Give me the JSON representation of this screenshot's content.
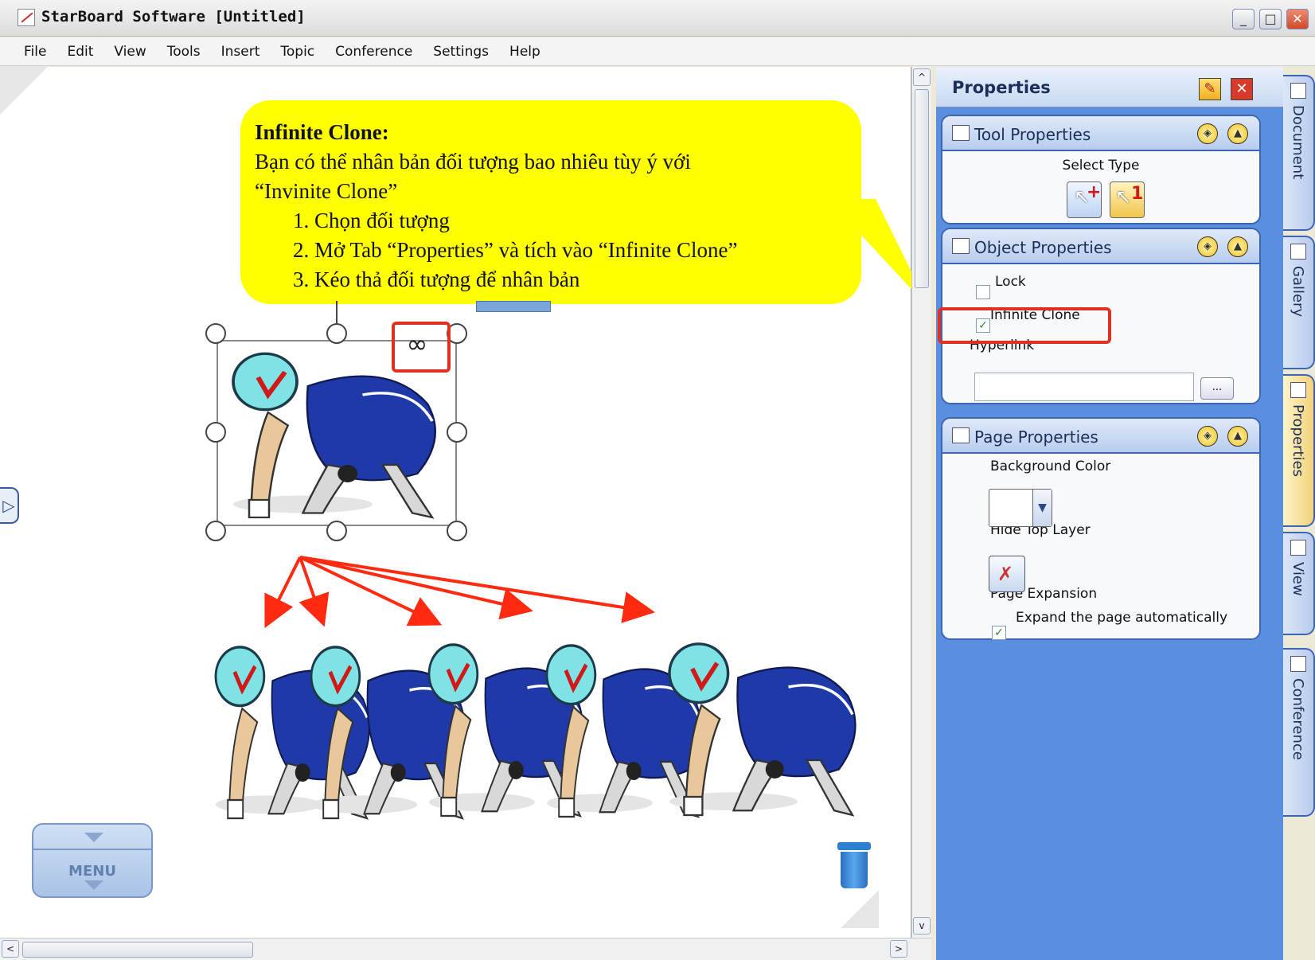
{
  "window": {
    "title": "StarBoard Software [Untitled]"
  },
  "menu": [
    "File",
    "Edit",
    "View",
    "Tools",
    "Insert",
    "Topic",
    "Conference",
    "Settings",
    "Help"
  ],
  "callout": {
    "heading": "Infinite Clone:",
    "line1": "Bạn có thể nhân bản đối tượng bao nhiêu tùy ý với",
    "line2": "“Invinite Clone”",
    "steps": [
      "1.  Chọn đối tượng",
      "2.  Mở Tab “Properties” và tích vào “Infinite Clone”",
      "3.  Kéo thả đối tượng để nhân bản"
    ]
  },
  "canvas": {
    "infinite_symbol": "∞",
    "menu_button_label": "MENU",
    "scroll_up": "^",
    "scroll_down": "v",
    "scroll_left": "<",
    "scroll_right": ">",
    "left_tab_arrow": "▷"
  },
  "panel": {
    "title": "Properties",
    "tool_properties": {
      "title": "Tool Properties",
      "select_type_label": "Select Type",
      "button_plus": "+",
      "button_one": "1"
    },
    "object_properties": {
      "title": "Object Properties",
      "lock_label": "Lock",
      "lock_checked": false,
      "infinite_clone_label": "Infinite Clone",
      "infinite_clone_checked": true,
      "hyperlink_label": "Hyperlink",
      "hyperlink_value": "",
      "browse_button": "..."
    },
    "page_properties": {
      "title": "Page Properties",
      "background_color_label": "Background Color",
      "background_color": "#ffffff",
      "hide_top_layer_label": "Hide Top Layer",
      "page_expansion_label": "Page Expansion",
      "expand_label": "Expand the page automatically",
      "expand_checked": true
    }
  },
  "side_tabs": [
    "Document",
    "Gallery",
    "Properties",
    "View",
    "Conference"
  ],
  "colors": {
    "callout": "#ffff00",
    "panel_bg": "#5a8fe0",
    "highlight_red": "#e03020",
    "arrow_red": "#ff2a10"
  }
}
